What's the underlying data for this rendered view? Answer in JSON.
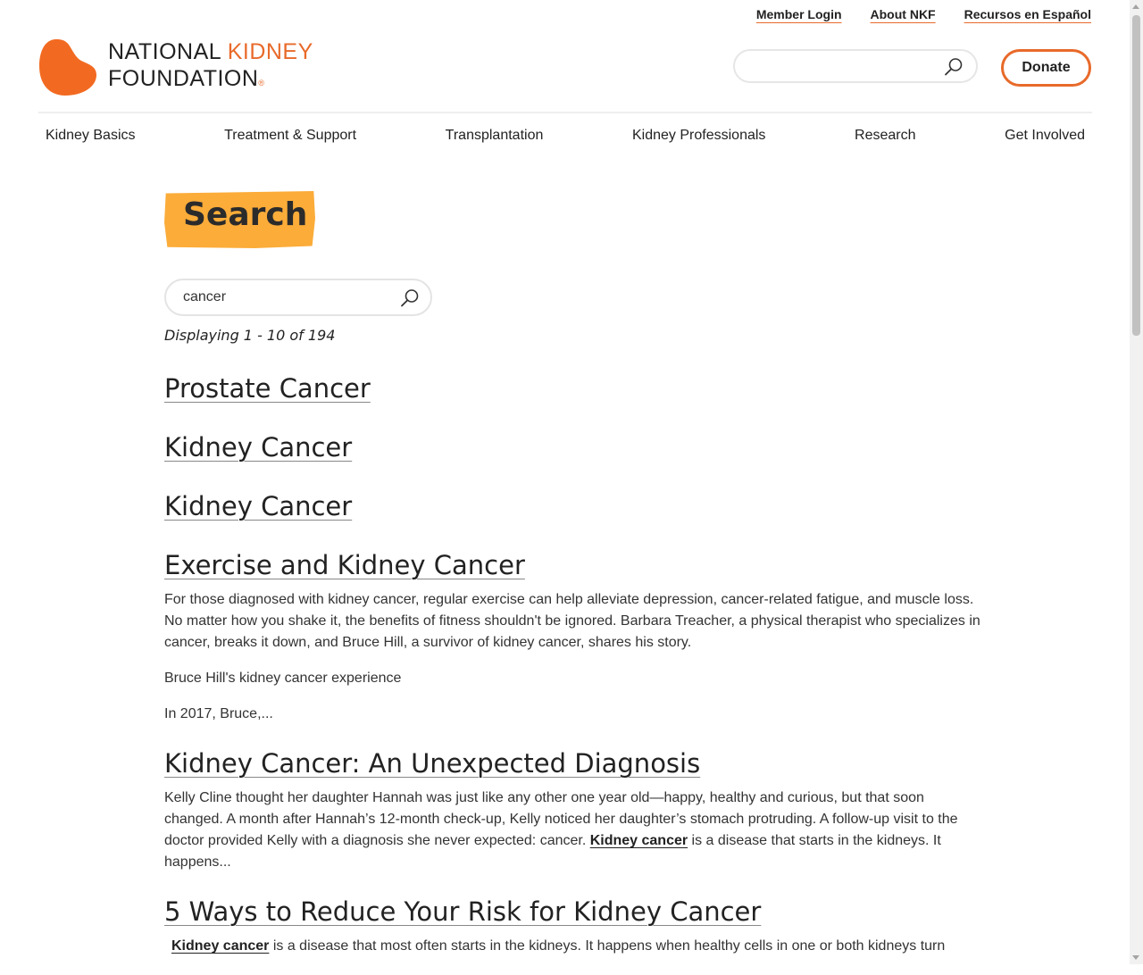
{
  "utility_nav": [
    "Member Login",
    "About NKF",
    "Recursos en Español"
  ],
  "logo": {
    "line1_a": "NATIONAL",
    "line1_b": "KIDNEY",
    "line2": "FOUNDATION",
    "reg": "®"
  },
  "header_search": {
    "placeholder": "",
    "value": ""
  },
  "donate_label": "Donate",
  "main_nav": [
    "Kidney Basics",
    "Treatment & Support",
    "Transplantation",
    "Kidney Professionals",
    "Research",
    "Get Involved"
  ],
  "page_title": "Search",
  "search": {
    "value": "cancer",
    "placeholder": ""
  },
  "result_count": "Displaying 1 - 10 of 194",
  "results": [
    {
      "title": "Prostate Cancer"
    },
    {
      "title": "Kidney Cancer"
    },
    {
      "title": "Kidney Cancer"
    },
    {
      "title": "Exercise and Kidney Cancer",
      "p1": "For those diagnosed with kidney cancer, regular exercise can help alleviate depression, cancer-related fatigue, and muscle loss. No matter how you shake it, the benefits of fitness shouldn't be ignored. Barbara Treacher, a physical therapist who specializes in cancer, breaks it down, and Bruce Hill, a survivor of kidney cancer, shares his story.",
      "p2": "Bruce Hill's kidney cancer experience",
      "p3": "In 2017, Bruce,..."
    },
    {
      "title": "Kidney Cancer: An Unexpected Diagnosis",
      "p1_before": "Kelly Cline thought her daughter Hannah was just like any other one year old—happy, healthy and curious, but that soon changed. A month after Hannah’s 12-month check-up, Kelly noticed her daughter’s stomach protruding. A follow-up visit to the doctor provided Kelly with a diagnosis she never expected: cancer. ",
      "p1_link": "Kidney cancer",
      "p1_after": " is a disease that starts in the kidneys. It happens..."
    },
    {
      "title": "5 Ways to Reduce Your Risk for Kidney Cancer",
      "p1_link": "Kidney cancer",
      "p1_after": " is a disease that most often starts in the kidneys. It happens when healthy cells in one or both kidneys turn"
    }
  ],
  "colors": {
    "accent": "#e86a2a",
    "highlight": "#fbac39"
  }
}
